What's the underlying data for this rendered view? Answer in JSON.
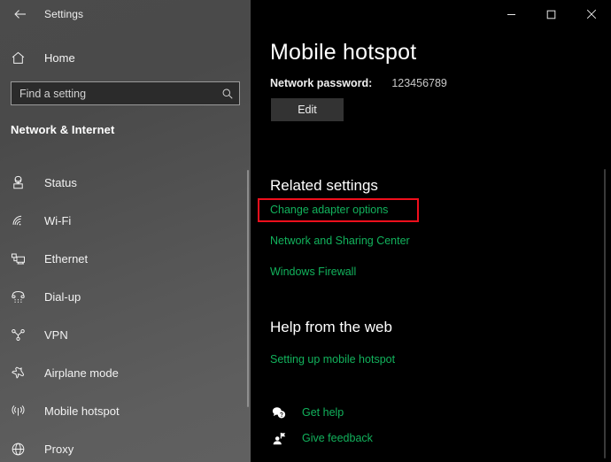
{
  "window": {
    "title": "Settings",
    "back_icon": "back-arrow-icon",
    "controls": {
      "minimize": "minimize-icon",
      "maximize": "maximize-icon",
      "close": "close-icon"
    }
  },
  "sidebar": {
    "home_label": "Home",
    "home_icon": "home-icon",
    "search": {
      "placeholder": "Find a setting",
      "value": "",
      "icon": "search-icon"
    },
    "section_title": "Network & Internet",
    "items": [
      {
        "label": "Status",
        "icon": "network-status-icon"
      },
      {
        "label": "Wi-Fi",
        "icon": "wifi-icon"
      },
      {
        "label": "Ethernet",
        "icon": "ethernet-icon"
      },
      {
        "label": "Dial-up",
        "icon": "dialup-phone-icon"
      },
      {
        "label": "VPN",
        "icon": "vpn-icon"
      },
      {
        "label": "Airplane mode",
        "icon": "airplane-icon"
      },
      {
        "label": "Mobile hotspot",
        "icon": "mobile-hotspot-icon"
      },
      {
        "label": "Proxy",
        "icon": "globe-proxy-icon"
      }
    ]
  },
  "main": {
    "page_title": "Mobile hotspot",
    "password_label": "Network password:",
    "password_value": "123456789",
    "edit_button": "Edit",
    "related_settings_heading": "Related settings",
    "related_links": [
      "Change adapter options",
      "Network and Sharing Center",
      "Windows Firewall"
    ],
    "help_heading": "Help from the web",
    "help_links": [
      "Setting up mobile hotspot"
    ],
    "footer_links": [
      {
        "label": "Get help",
        "icon": "help-bubble-icon"
      },
      {
        "label": "Give feedback",
        "icon": "feedback-person-icon"
      }
    ]
  },
  "annotations": {
    "highlight_target": "Change adapter options",
    "highlight_color": "#f10f1c"
  },
  "colors": {
    "accent_link": "#12b25c",
    "sidebar_bg": "#4f4f4f",
    "main_bg": "#000000",
    "highlight": "#f10f1c"
  }
}
